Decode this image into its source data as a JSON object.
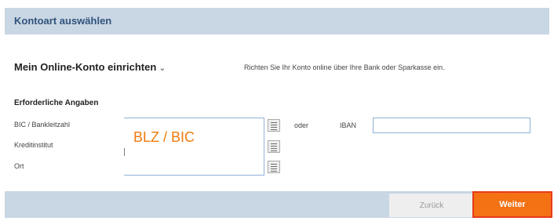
{
  "header": {
    "title": "Kontoart auswählen"
  },
  "setup": {
    "title": "Mein Online-Konto einrichten",
    "chevron_icon": "chevron-down-icon",
    "description": "Richten Sie Ihr Konto online über Ihre Bank oder Sparkasse ein."
  },
  "form": {
    "section_title": "Erforderliche Angaben",
    "bic_label": "BIC / Bankleitzahl",
    "kreditinstitut_label": "Kreditinstitut",
    "ort_label": "Ort",
    "bank_search_hint": "BLZ / BIC",
    "or_text": "oder",
    "iban_label": "IBAN",
    "iban_value": ""
  },
  "footer": {
    "back_label": "Zurück",
    "next_label": "Weiter"
  },
  "colors": {
    "bar_background": "#c9d6e3",
    "header_text": "#30537d",
    "accent_orange": "#f47114",
    "hint_orange": "#f07a0c",
    "highlight_border": "#e53b1c"
  }
}
